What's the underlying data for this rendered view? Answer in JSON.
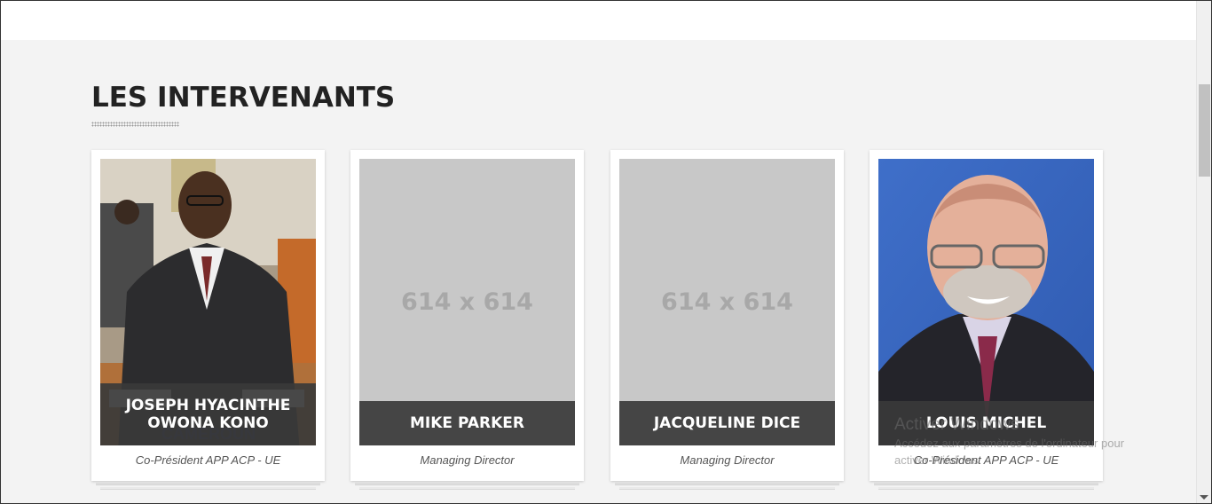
{
  "section": {
    "title": "LES INTERVENANTS"
  },
  "placeholder_label": "614 x 614",
  "speakers": [
    {
      "name": "JOSEPH HYACINTHE OWONA KONO",
      "role": "Co-Président APP ACP - UE",
      "photo": "portrait-photo"
    },
    {
      "name": "MIKE PARKER",
      "role": "Managing Director",
      "photo": "placeholder"
    },
    {
      "name": "JACQUELINE DICE",
      "role": "Managing Director",
      "photo": "placeholder"
    },
    {
      "name": "LOUIS MICHEL",
      "role": "Co-Président APP ACP - UE",
      "photo": "portrait-photo"
    }
  ],
  "windows_watermark": {
    "title": "Activer Windows",
    "line1": "Accédez aux paramètres de l'ordinateur pour",
    "line2": "activer Windows."
  },
  "colors": {
    "page_bg": "#f3f3f3",
    "name_bar": "#3a3a3a",
    "placeholder_bg": "#c8c8c8"
  }
}
